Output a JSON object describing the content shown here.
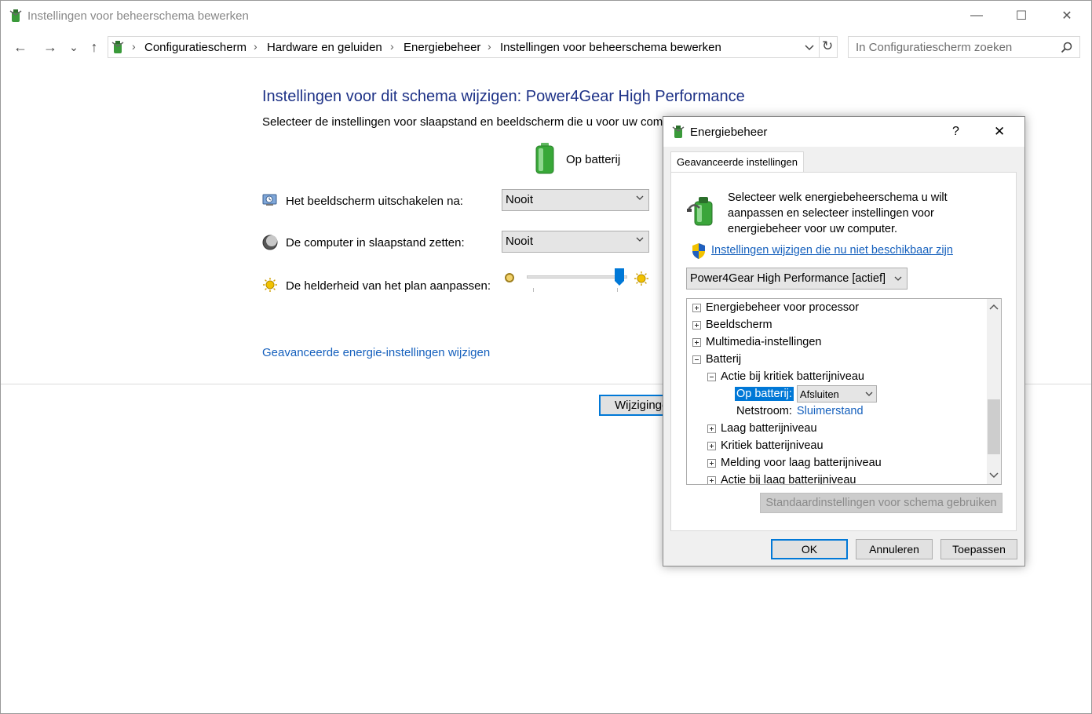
{
  "window": {
    "title": "Instellingen voor beheerschema bewerken",
    "minimize": "—",
    "maximize": "☐",
    "close": "✕"
  },
  "nav": {
    "back": "←",
    "forward": "→",
    "history": "⌄",
    "up": "↑",
    "breadcrumbs": [
      "Configuratiescherm",
      "Hardware en geluiden",
      "Energiebeheer",
      "Instellingen voor beheerschema bewerken"
    ],
    "separator": "›",
    "refresh": "↻",
    "search_placeholder": "In Configuratiescherm zoeken"
  },
  "main": {
    "title": "Instellingen voor dit schema wijzigen: Power4Gear High Performance",
    "subtitle": "Selecteer de instellingen voor slaapstand en beeldscherm die u voor uw computer wilt gebruiken.",
    "column_label": "Op batterij",
    "rows": [
      {
        "label": "Het beeldscherm uitschakelen na:",
        "value": "Nooit"
      },
      {
        "label": "De computer in slaapstand zetten:",
        "value": "Nooit"
      },
      {
        "label": "De helderheid van het plan aanpassen:",
        "slider_fraction": 0.92
      }
    ],
    "advanced_link": "Geavanceerde energie-instellingen wijzigen",
    "save_button": "Wijzigingen opslaan"
  },
  "dialog": {
    "title": "Energiebeheer",
    "help": "?",
    "close": "✕",
    "tab": "Geavanceerde instellingen",
    "description": "Selecteer welk energiebeheerschema u wilt aanpassen en selecteer instellingen voor energiebeheer voor uw computer.",
    "unavailable_link": "Instellingen wijzigen die nu niet beschikbaar zijn",
    "scheme_select": "Power4Gear High Performance [actief]",
    "tree": {
      "processor": "Energiebeheer voor processor",
      "display": "Beeldscherm",
      "multimedia": "Multimedia-instellingen",
      "battery": "Batterij",
      "critical_action": "Actie bij kritiek batterijniveau",
      "on_battery_label": "Op batterij:",
      "on_battery_value": "Afsluiten",
      "plugged_label": "Netstroom:",
      "plugged_value": "Sluimerstand",
      "low_level": "Laag batterijniveau",
      "critical_level": "Kritiek batterijniveau",
      "low_notification": "Melding voor laag batterijniveau",
      "low_action": "Actie bij laag batterijniveau"
    },
    "restore_button": "Standaardinstellingen voor schema gebruiken",
    "ok": "OK",
    "cancel": "Annuleren",
    "apply": "Toepassen"
  }
}
